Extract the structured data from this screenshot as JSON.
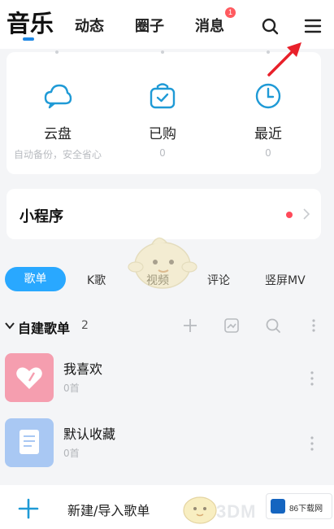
{
  "nav": {
    "tabs": [
      {
        "label": "音乐",
        "active": true
      },
      {
        "label": "动态"
      },
      {
        "label": "圈子"
      },
      {
        "label": "消息"
      }
    ],
    "badge_count": "1",
    "icons": [
      "search-icon",
      "menu-icon"
    ]
  },
  "shortcuts": [
    {
      "label": "云盘",
      "sub": "自动备份，安全省心",
      "icon": "cloud-icon"
    },
    {
      "label": "已购",
      "sub": "0",
      "icon": "bag-check-icon"
    },
    {
      "label": "最近",
      "sub": "0",
      "icon": "clock-icon"
    }
  ],
  "mini": {
    "title": "小程序"
  },
  "tabs": [
    {
      "label": "歌单",
      "active": true
    },
    {
      "label": "K歌"
    },
    {
      "label": "视频"
    },
    {
      "label": "评论"
    },
    {
      "label": "竖屏MV"
    }
  ],
  "playlists_header": {
    "title": "自建歌单",
    "count": "2"
  },
  "playlists": [
    {
      "title": "我喜欢",
      "count": "0首",
      "cover": "#f59eaf"
    },
    {
      "title": "默认收藏",
      "count": "0首",
      "cover": "#a9c8f3"
    }
  ],
  "bottom": {
    "label": "新建/导入歌单",
    "watermark": "3DM",
    "logo_text": "86下载网"
  },
  "colors": {
    "accent": "#29a8ff",
    "active_underline": "#1e88e5",
    "badge": "#ff5a5f",
    "arrow": "#e8202a"
  }
}
